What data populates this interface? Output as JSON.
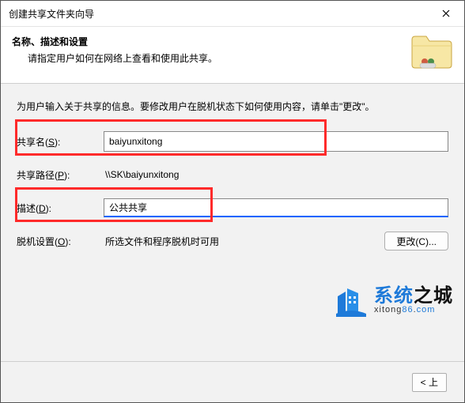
{
  "titlebar": {
    "title": "创建共享文件夹向导"
  },
  "header": {
    "title": "名称、描述和设置",
    "subtitle": "请指定用户如何在网络上查看和使用此共享。"
  },
  "intro": "为用户输入关于共享的信息。要修改用户在脱机状态下如何使用内容，请单击\"更改\"。",
  "fields": {
    "share_name": {
      "label_pre": "共享名(",
      "label_u": "S",
      "label_post": "):",
      "value": "baiyunxitong"
    },
    "share_path": {
      "label_pre": "共享路径(",
      "label_u": "P",
      "label_post": "):",
      "value": "\\\\SK\\baiyunxitong"
    },
    "description": {
      "label_pre": "描述(",
      "label_u": "D",
      "label_post": "):",
      "value": "公共共享"
    },
    "offline": {
      "label_pre": "脱机设置(",
      "label_u": "O",
      "label_post": "):",
      "value": "所选文件和程序脱机时可用",
      "button": "更改(C)..."
    }
  },
  "footer": {
    "back": "< 上"
  },
  "watermark": {
    "brand_a": "系统",
    "brand_b": "之城",
    "url_plain": "xitong",
    "url_blue1": "86",
    "url_dot1": ".",
    "url_com": "com"
  }
}
